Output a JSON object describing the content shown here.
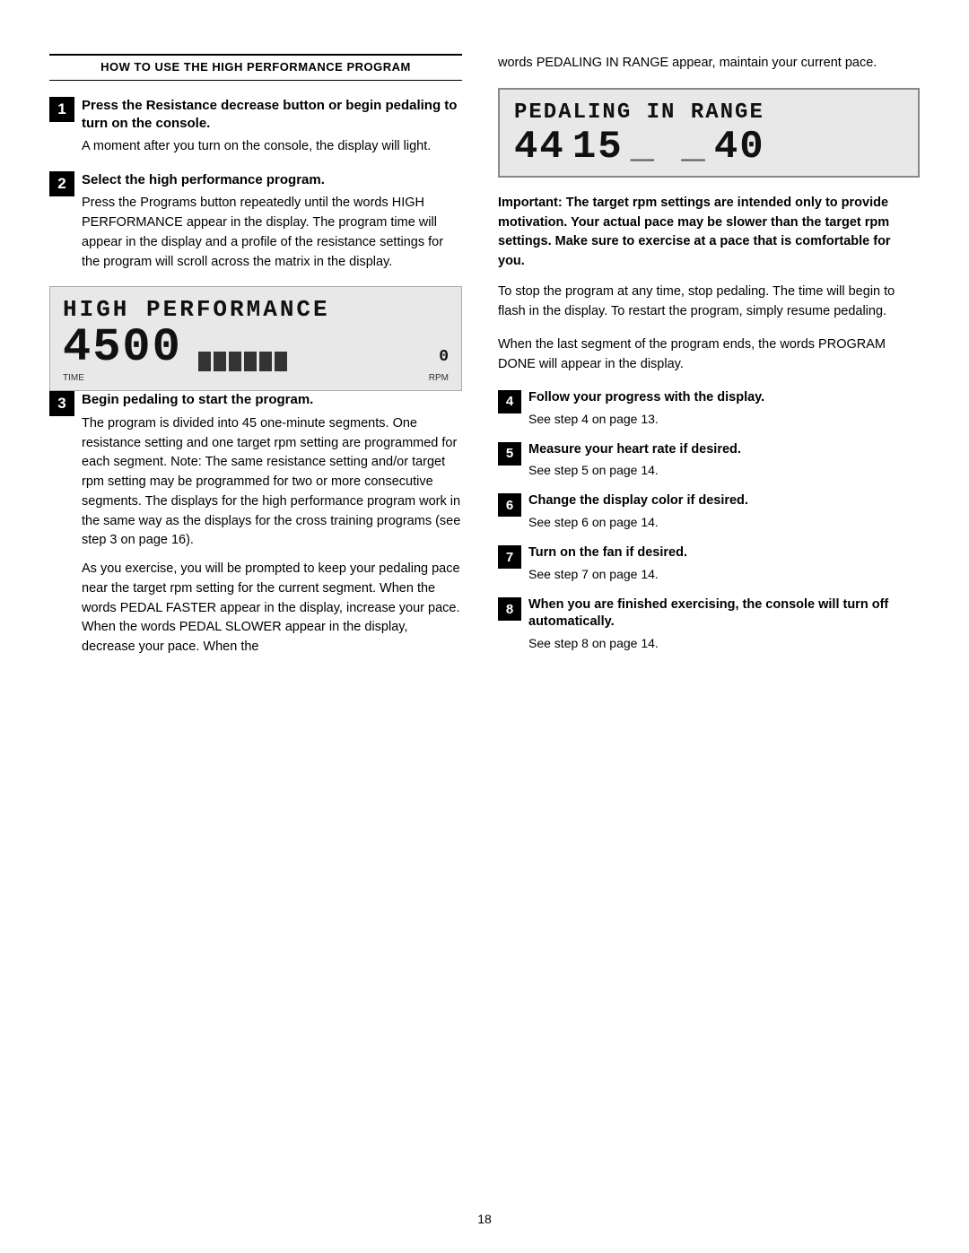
{
  "header": {
    "title": "HOW TO USE THE HIGH PERFORMANCE PROGRAM"
  },
  "left": {
    "step1": {
      "number": "1",
      "title": "Press the Resistance decrease button or begin pedaling to turn on the console.",
      "body": "A moment after you turn on the console, the display will light."
    },
    "step2": {
      "number": "2",
      "title": "Select the high performance program.",
      "body": "Press the Programs button repeatedly until the words HIGH PERFORMANCE appear in the display. The program time will appear in the display and a profile of the resistance settings for the program will scroll across the matrix in the display."
    },
    "lcd_high": {
      "top_text": "HIGH PERFORMANCE",
      "big_num": "4500",
      "rpm_label": "0",
      "time_label": "TIME",
      "rpm_unit": "RPM"
    },
    "step3": {
      "number": "3",
      "title": "Begin pedaling to start the program.",
      "body1": "The program is divided into 45 one-minute segments. One resistance setting and one target rpm setting are programmed for each segment. Note: The same resistance setting and/or target rpm setting may be programmed for two or more consecutive segments. The displays for the high performance program work in the same way as the displays for the cross training programs (see step 3 on page 16).",
      "body2": "As you exercise, you will be prompted to keep your pedaling pace near the target rpm setting for the current segment. When the words PEDAL FASTER appear in the display, increase your pace. When the words PEDAL SLOWER appear in the display, decrease your pace. When the"
    }
  },
  "right": {
    "intro": "words PEDALING IN RANGE appear, maintain your current pace.",
    "lcd_range": {
      "top_text": "PEDALING IN RANGE",
      "num1": "44",
      "num2": "15",
      "num3": "40"
    },
    "bold_para": "Important: The target rpm settings are intended only to provide motivation. Your actual pace may be slower than the target rpm settings. Make sure to exercise at a pace that is comfortable for you.",
    "stop_para": "To stop the program at any time, stop pedaling. The time will begin to flash in the display. To restart the program, simply resume pedaling.",
    "last_para": "When the last segment of the program ends, the words PROGRAM DONE will appear in the display.",
    "step4": {
      "number": "4",
      "title": "Follow your progress with the display.",
      "body": "See step 4 on page 13."
    },
    "step5": {
      "number": "5",
      "title": "Measure your heart rate if desired.",
      "body": "See step 5 on page 14."
    },
    "step6": {
      "number": "6",
      "title": "Change the display color if desired.",
      "body": "See step 6 on page 14."
    },
    "step7": {
      "number": "7",
      "title": "Turn on the fan if desired.",
      "body": "See step 7 on page 14."
    },
    "step8": {
      "number": "8",
      "title": "When you are finished exercising, the console will turn off automatically.",
      "body": "See step 8 on page 14."
    }
  },
  "page_number": "18"
}
